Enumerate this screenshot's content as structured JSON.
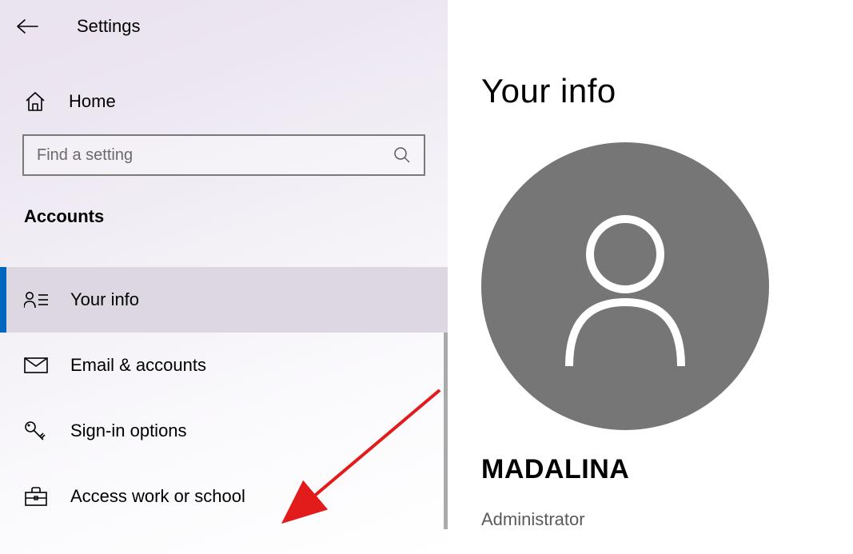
{
  "header": {
    "title": "Settings"
  },
  "home": {
    "label": "Home"
  },
  "search": {
    "placeholder": "Find a setting"
  },
  "section": {
    "heading": "Accounts"
  },
  "nav": {
    "items": [
      {
        "label": "Your info",
        "icon": "user-list-icon",
        "selected": true
      },
      {
        "label": "Email & accounts",
        "icon": "envelope-icon",
        "selected": false
      },
      {
        "label": "Sign-in options",
        "icon": "key-icon",
        "selected": false
      },
      {
        "label": "Access work or school",
        "icon": "briefcase-icon",
        "selected": false
      }
    ]
  },
  "page": {
    "heading": "Your info"
  },
  "user": {
    "name": "MADALINA",
    "role": "Administrator"
  }
}
